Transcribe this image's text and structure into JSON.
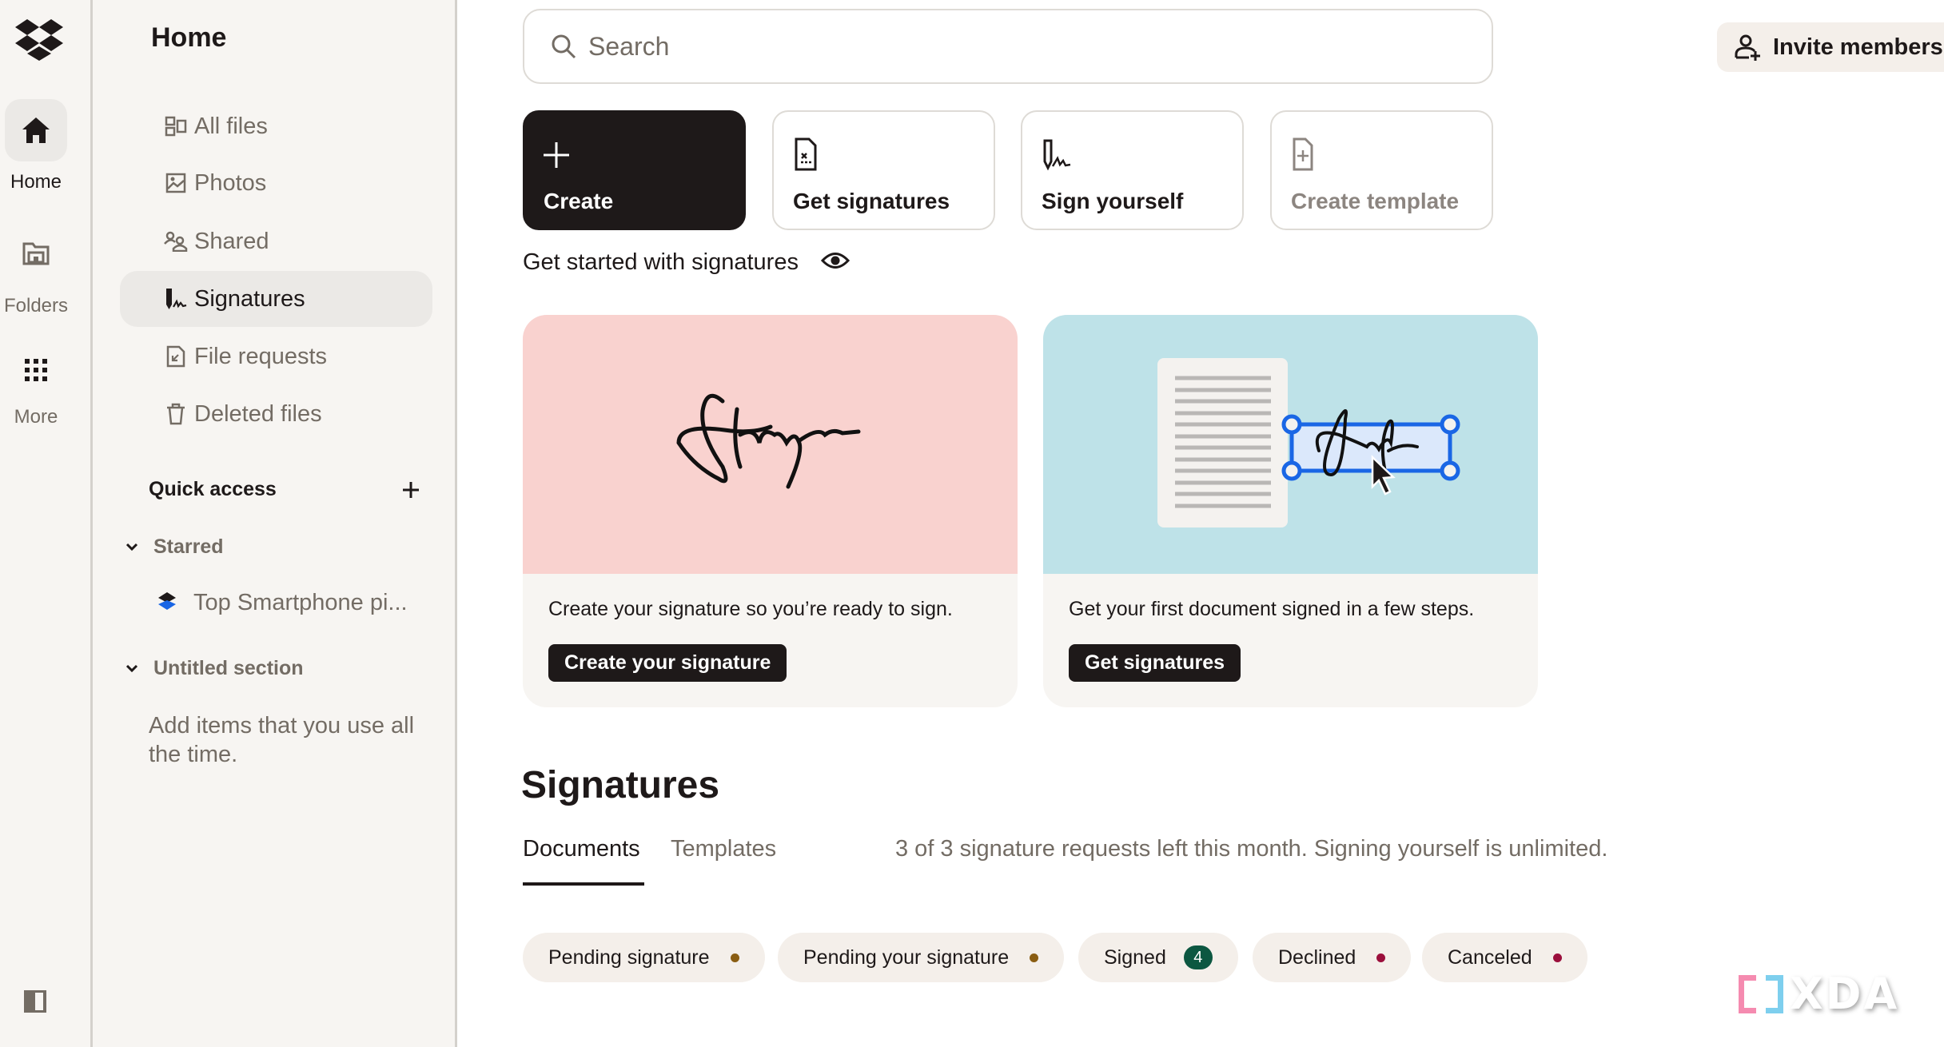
{
  "rail": {
    "items": [
      {
        "label": "Home",
        "icon": "home-icon",
        "active": true
      },
      {
        "label": "Folders",
        "icon": "folder-icon",
        "active": false
      },
      {
        "label": "More",
        "icon": "grid-icon",
        "active": false
      }
    ],
    "logo": "dropbox-logo",
    "toggle": "sidebar-toggle-icon"
  },
  "sidebar": {
    "title": "Home",
    "nav": [
      {
        "label": "All files",
        "icon": "all-files-icon"
      },
      {
        "label": "Photos",
        "icon": "photos-icon"
      },
      {
        "label": "Shared",
        "icon": "shared-icon"
      },
      {
        "label": "Signatures",
        "icon": "signatures-icon",
        "active": true
      },
      {
        "label": "File requests",
        "icon": "file-requests-icon"
      },
      {
        "label": "Deleted files",
        "icon": "trash-icon"
      }
    ],
    "quick_access": {
      "title": "Quick access",
      "add_icon": "plus-icon",
      "starred": {
        "label": "Starred",
        "items": [
          {
            "label": "Top Smartphone pi...",
            "icon": "stack-file-icon"
          }
        ]
      },
      "untitled": {
        "label": "Untitled section",
        "hint": "Add items that you use all the time."
      }
    }
  },
  "header": {
    "search_placeholder": "Search",
    "invite_label": "Invite members"
  },
  "actions": [
    {
      "label": "Create",
      "icon": "plus-icon",
      "variant": "primary"
    },
    {
      "label": "Get signatures",
      "icon": "document-signature-icon",
      "variant": "default"
    },
    {
      "label": "Sign yourself",
      "icon": "pen-sign-icon",
      "variant": "default"
    },
    {
      "label": "Create template",
      "icon": "document-add-icon",
      "variant": "disabled"
    }
  ],
  "get_started": {
    "label": "Get started with signatures",
    "icon": "eye-icon"
  },
  "cards": [
    {
      "description": "Create your signature so you’re ready to sign.",
      "button": "Create your signature",
      "bg": "#f9d2cf"
    },
    {
      "description": "Get your first document signed in a few steps.",
      "button": "Get signatures",
      "bg": "#bee2e8"
    }
  ],
  "signatures": {
    "heading": "Signatures",
    "tabs": [
      {
        "label": "Documents",
        "active": true
      },
      {
        "label": "Templates",
        "active": false
      }
    ],
    "quota_text": "3 of 3 signature requests left this month. Signing yourself is unlimited.",
    "filters": [
      {
        "label": "Pending signature",
        "dot": "#8a5d12"
      },
      {
        "label": "Pending your signature",
        "dot": "#8a5d12"
      },
      {
        "label": "Signed",
        "count": "4"
      },
      {
        "label": "Declined",
        "dot": "#9b0f3c"
      },
      {
        "label": "Canceled",
        "dot": "#9b0f3c"
      }
    ]
  },
  "watermark": {
    "text": "XDA"
  }
}
